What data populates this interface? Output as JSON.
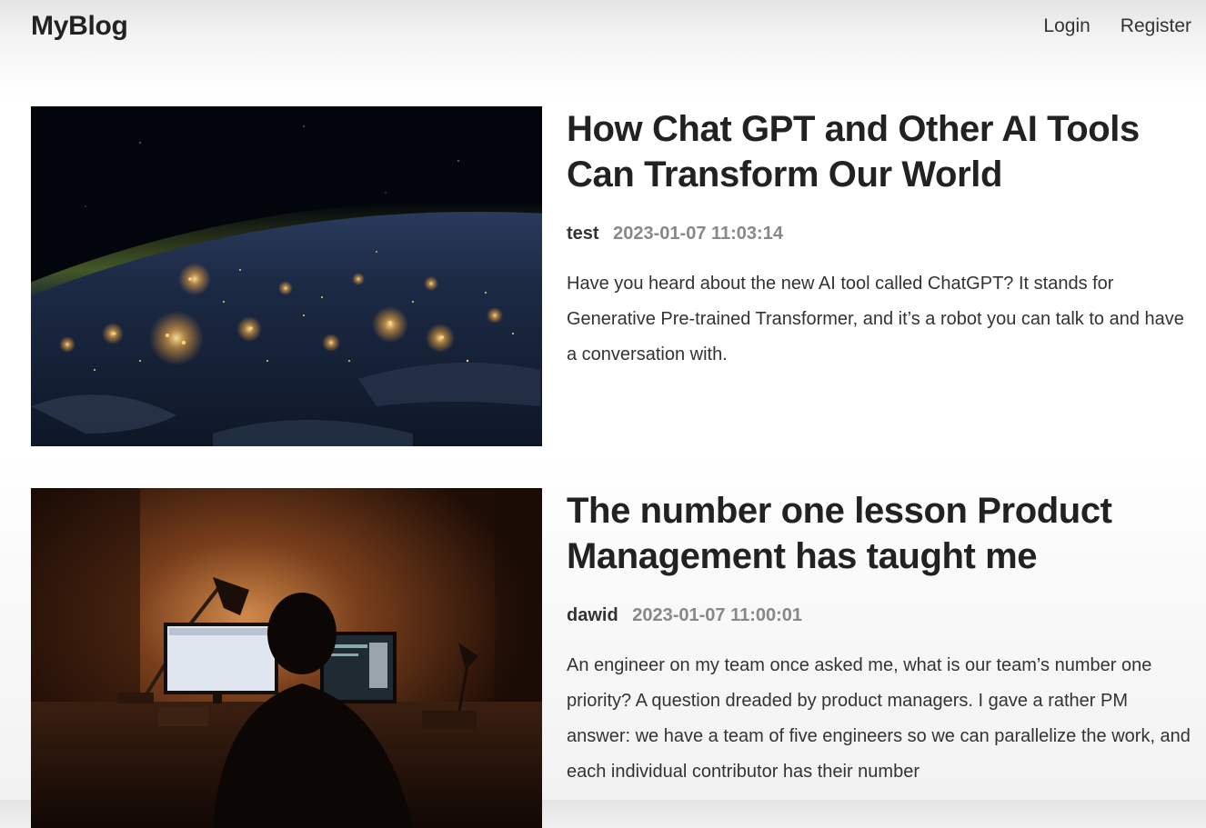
{
  "header": {
    "logo": "MyBlog",
    "nav": {
      "login": "Login",
      "register": "Register"
    }
  },
  "posts": [
    {
      "title": "How Chat GPT and Other AI Tools Can Transform Our World",
      "author": "test",
      "date": "2023-01-07 11:03:14",
      "summary": "Have you heard about the new AI tool called ChatGPT? It stands for Generative Pre-trained Transformer, and it’s a robot you can talk to and have a conversation with."
    },
    {
      "title": "The number one lesson Product Management has taught me",
      "author": "dawid",
      "date": "2023-01-07 11:00:01",
      "summary": "An engineer on my team once asked me, what is our team’s number one priority? A question dreaded by product managers. I gave a rather PM answer: we have a team of five engineers so we can parallelize the work, and each individual contributor has their number"
    }
  ]
}
